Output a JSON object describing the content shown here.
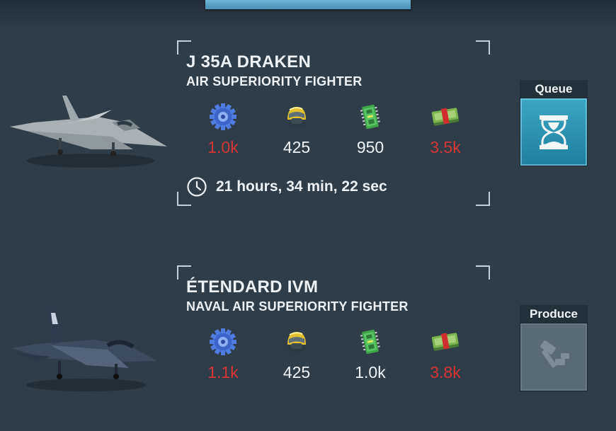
{
  "units": [
    {
      "name": "J 35A DRAKEN",
      "role": "AIR SUPERIORITY FIGHTER",
      "costs": [
        {
          "icon": "gear-parts-icon",
          "value": "1.0k",
          "insufficient": true
        },
        {
          "icon": "pilot-helmet-icon",
          "value": "425",
          "insufficient": false
        },
        {
          "icon": "circuit-board-icon",
          "value": "950",
          "insufficient": false
        },
        {
          "icon": "cash-stack-icon",
          "value": "3.5k",
          "insufficient": true
        }
      ],
      "time": "21 hours, 34 min, 22 sec",
      "action": {
        "label": "Queue",
        "icon": "hourglass-icon",
        "enabled": true
      }
    },
    {
      "name": "ÉTENDARD IVM",
      "role": "NAVAL AIR SUPERIORITY FIGHTER",
      "costs": [
        {
          "icon": "gear-parts-icon",
          "value": "1.1k",
          "insufficient": true
        },
        {
          "icon": "pilot-helmet-icon",
          "value": "425",
          "insufficient": false
        },
        {
          "icon": "circuit-board-icon",
          "value": "1.0k",
          "insufficient": false
        },
        {
          "icon": "cash-stack-icon",
          "value": "3.8k",
          "insufficient": true
        }
      ],
      "action": {
        "label": "Produce",
        "icon": "hammer-icon",
        "enabled": false
      }
    }
  ],
  "colors": {
    "background": "#2f3d48",
    "insufficient": "#d63434",
    "queue_button": "#2a93b3",
    "produce_button_disabled": "#5a6a75"
  }
}
